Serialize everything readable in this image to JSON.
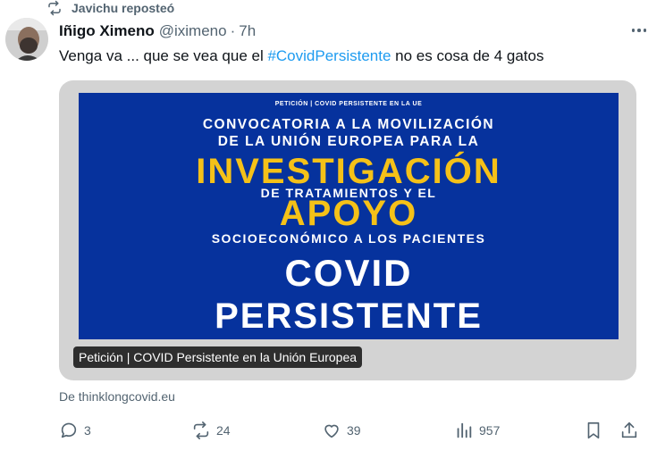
{
  "repost": {
    "label": "Javichu reposteó",
    "icon": "repost-icon"
  },
  "tweet": {
    "author_name": "Iñigo Ximeno",
    "handle": "@iximeno",
    "separator": "·",
    "time": "7h",
    "text_before": "Venga va ... que se vea que el ",
    "hashtag": "#CovidPersistente",
    "text_after": " no es cosa de 4 gatos"
  },
  "card": {
    "poster": {
      "small_header": "PETICIÓN | COVID PERSISTENTE EN LA UE",
      "line1": "CONVOCATORIA A LA MOVILIZACIÓN",
      "line2": "DE LA UNIÓN EUROPEA PARA LA",
      "line3": "INVESTIGACIÓN",
      "line4": "DE TRATAMIENTOS Y EL",
      "line5": "APOYO",
      "line6": "SOCIOECONÓMICO A LOS PACIENTES",
      "line7": "COVID",
      "line8": "PERSISTENTE"
    },
    "label": "Petición | COVID Persistente en la Unión Europea",
    "source": "De thinklongcovid.eu"
  },
  "actions": {
    "reply_count": "3",
    "repost_count": "24",
    "like_count": "39",
    "views_count": "957"
  },
  "colors": {
    "accent": "#1d9bf0",
    "muted": "#536471",
    "poster_bg": "#06329d",
    "poster_yellow": "#f5c118"
  }
}
